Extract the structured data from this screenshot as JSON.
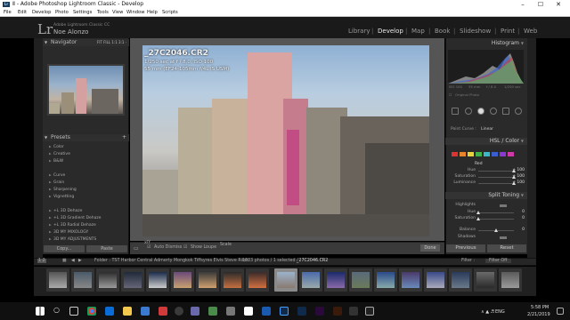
{
  "window": {
    "title": "Ⅱ - Adobe Photoshop Lightroom Classic - Develop",
    "min": "–",
    "max": "☐",
    "close": "✕",
    "app_badge": "Lr"
  },
  "menu": [
    "File",
    "Edit",
    "Develop",
    "Photo",
    "Settings",
    "Tools",
    "View",
    "Window",
    "Help",
    "Scripts"
  ],
  "identity": {
    "logo": "Lr",
    "app_name": "Adobe Lightroom Classic CC",
    "user": "Noe Alonzo"
  },
  "modules": [
    {
      "label": "Library",
      "active": false
    },
    {
      "label": "Develop",
      "active": true
    },
    {
      "label": "Map",
      "active": false
    },
    {
      "label": "Book",
      "active": false
    },
    {
      "label": "Slideshow",
      "active": false
    },
    {
      "label": "Print",
      "active": false
    },
    {
      "label": "Web",
      "active": false
    }
  ],
  "left_panel": {
    "navigator": {
      "title": "Navigator",
      "zoom_options": "FIT  FILL  1:1  3:1 ·"
    },
    "presets": {
      "title": "Presets",
      "add_icon": "+",
      "items": [
        "Color",
        "Creative",
        "B&W",
        "Curve",
        "Grain",
        "Sharpening",
        "Vignetting",
        "+L 3D Dehaze",
        "+L 3D Gradient Dehaze",
        "+L 3D Radial Dehaze",
        "3D MY MIXOLOGY",
        "3D MY ADJUSTMENTS"
      ]
    },
    "copy_label": "Copy...",
    "paste_label": "Paste"
  },
  "photo_overlay": {
    "filename": "_27C2046.CR2",
    "line1": "1/250 sec at f / 8.0, ISO 100",
    "line2": "55 mm (EF24-105mm f/4L IS USM)"
  },
  "toolbar": {
    "view_icon": "▭",
    "ab_label": "xlY",
    "auto_dismiss": "Auto Dismiss",
    "show_loupe": "Show Loupe",
    "scale_label": "Scale",
    "done_label": "Done"
  },
  "right_panel": {
    "histogram_title": "Histogram",
    "histogram_info": [
      "ISO 100",
      "55 mm",
      "f / 8.0",
      "1/250 sec"
    ],
    "original_photo": "Original Photo",
    "point_curve_label": "Point Curve :",
    "point_curve_value": "Linear",
    "hsl_header": "HSL / Color",
    "hsl_group": "Red",
    "hsl_sliders": [
      {
        "label": "Hue",
        "value": "+ 100",
        "pos": 1.0
      },
      {
        "label": "Saturation",
        "value": "+ 100",
        "pos": 1.0
      },
      {
        "label": "Luminance",
        "value": "+ 100",
        "pos": 1.0
      }
    ],
    "split_header": "Split Toning",
    "split_sliders": [
      {
        "label": "Highlights",
        "value": "",
        "pos": 0.7
      },
      {
        "label": "Hue",
        "value": "0",
        "pos": 0.0
      },
      {
        "label": "Saturation",
        "value": "0",
        "pos": 0.0
      },
      {
        "label": "Balance",
        "value": "0",
        "pos": 0.5
      },
      {
        "label": "Shadows",
        "value": "",
        "pos": 0.7
      },
      {
        "label": "Hue",
        "value": "0",
        "pos": 0.0
      },
      {
        "label": "Saturation",
        "value": "0",
        "pos": 0.0
      }
    ],
    "previous_label": "Previous",
    "reset_label": "Reset"
  },
  "filmstrip": {
    "page_nums": "1  2",
    "folder": "Folder : TST Harbor Central Admerty Mongkok Tiffsyres Elvis Steve Riich",
    "count": "1033 photos / 1 selected /",
    "selected_file": "_27C2046.CR2",
    "filter_label": "Filter :",
    "filter_value": "Filter Off"
  },
  "taskbar": {
    "search_icon": "○",
    "time": "5:58 PM",
    "date": "2/21/2019",
    "lang": "ENG"
  },
  "colors": {
    "panel": "#2a2a2a",
    "accent_active": "#e8e8e8",
    "hsl_red": "#d33"
  }
}
